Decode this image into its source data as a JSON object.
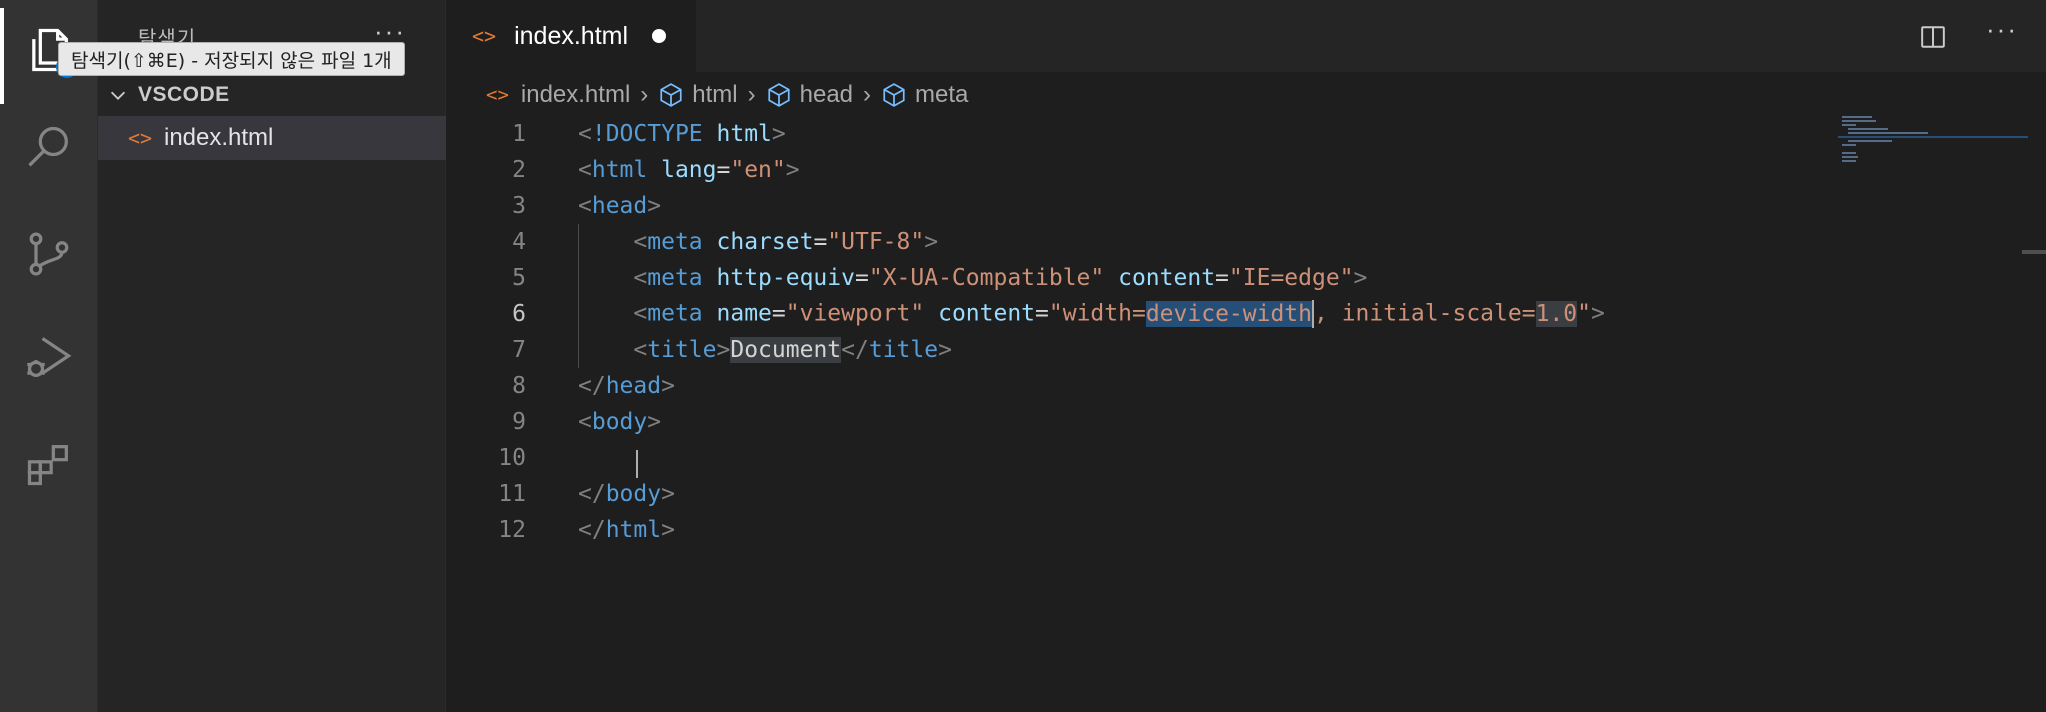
{
  "tooltip": "탐색기(⇧⌘E) - 저장되지 않은 파일 1개",
  "sidebar": {
    "title": "탐색기",
    "more": "···",
    "section": "VSCODE",
    "file": "index.html"
  },
  "tab": {
    "label": "index.html"
  },
  "breadcrumb": {
    "file": "index.html",
    "items": [
      "html",
      "head",
      "meta"
    ]
  },
  "editor": {
    "lines": [
      {
        "n": "1"
      },
      {
        "n": "2"
      },
      {
        "n": "3"
      },
      {
        "n": "4"
      },
      {
        "n": "5"
      },
      {
        "n": "6"
      },
      {
        "n": "7"
      },
      {
        "n": "8"
      },
      {
        "n": "9"
      },
      {
        "n": "10"
      },
      {
        "n": "11"
      },
      {
        "n": "12"
      }
    ],
    "code": {
      "l1_doctype": "!DOCTYPE",
      "l1_html": "html",
      "l2_tag": "html",
      "l2_attr": "lang",
      "l2_val": "\"en\"",
      "l3_tag": "head",
      "l4_tag": "meta",
      "l4_attr": "charset",
      "l4_val": "\"UTF-8\"",
      "l5_tag": "meta",
      "l5_attr1": "http-equiv",
      "l5_val1": "\"X-UA-Compatible\"",
      "l5_attr2": "content",
      "l5_val2": "\"IE=edge\"",
      "l6_tag": "meta",
      "l6_attr1": "name",
      "l6_val1": "\"viewport\"",
      "l6_attr2": "content",
      "l6_val2a": "\"width=",
      "l6_val2b": "device-width",
      "l6_val2c": ", initial-scale=",
      "l6_val2d": "1.0",
      "l6_val2e": "\"",
      "l7_tag": "title",
      "l7_text": "Document",
      "l8_tag": "head",
      "l9_tag": "body",
      "l11_tag": "body",
      "l12_tag": "html"
    }
  },
  "colors": {
    "accent": "#0078d4",
    "file_icon": "#e37933"
  }
}
